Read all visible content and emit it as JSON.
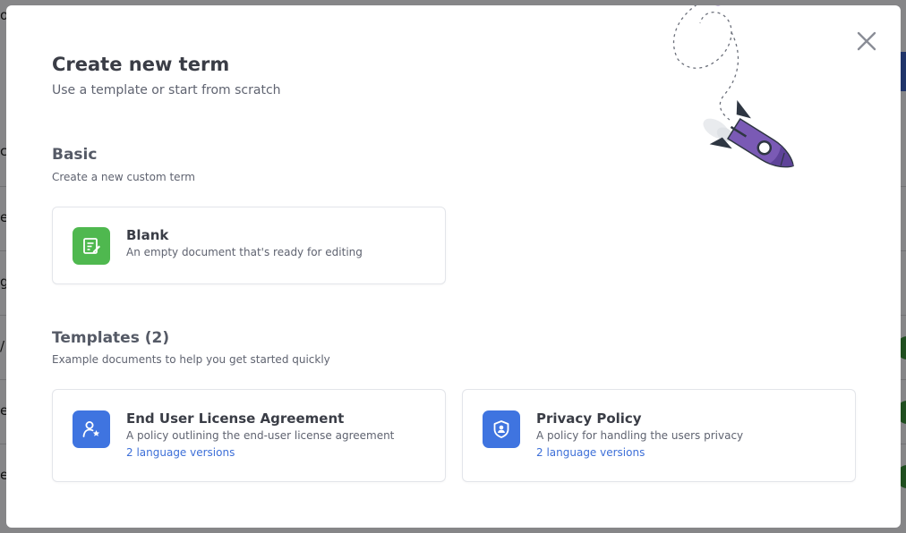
{
  "colors": {
    "blank_icon_bg": "#4fb84f",
    "template_icon_bg": "#3f74e0",
    "link": "#3d6fd8",
    "rocket": "#7a5ab5"
  },
  "modal": {
    "title": "Create new term",
    "subtitle": "Use a template or start from scratch",
    "close_icon": "close-icon",
    "basic": {
      "title": "Basic",
      "description": "Create a new custom term",
      "card": {
        "icon": "edit-document-icon",
        "title": "Blank",
        "description": "An empty document that's ready for editing"
      }
    },
    "templates": {
      "title": "Templates (2)",
      "description": "Example documents to help you get started quickly",
      "items": [
        {
          "icon": "user-badge-icon",
          "title": "End User License Agreement",
          "description": "A policy outlining the end-user license agreement",
          "link": "2 language versions"
        },
        {
          "icon": "shield-user-icon",
          "title": "Privacy Policy",
          "description": "A policy for handling the users privacy",
          "link": "2 language versions"
        }
      ]
    }
  },
  "background": {
    "left_fragments": [
      "o",
      "c",
      "e",
      "g",
      "/",
      "e",
      "e"
    ]
  }
}
